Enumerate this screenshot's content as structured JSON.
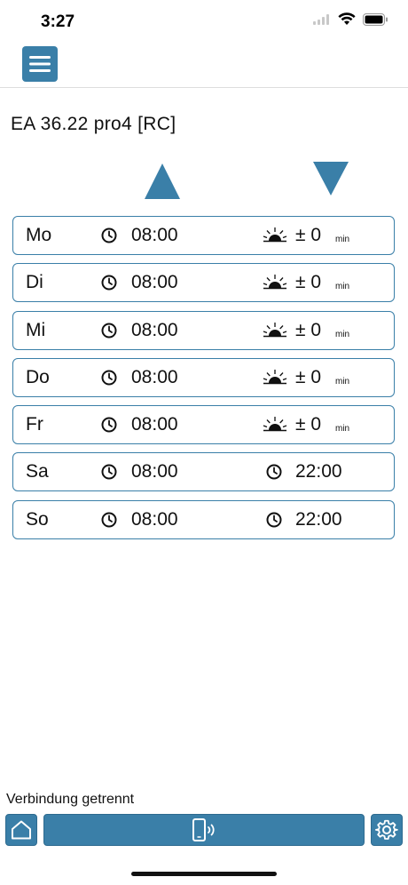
{
  "status_bar": {
    "time": "3:27"
  },
  "header": {
    "menu_icon": "hamburger-menu-icon"
  },
  "device": {
    "name": "EA 36.22 pro4 [RC]"
  },
  "colors": {
    "accent": "#3a7fa8",
    "border": "#3a7fa8"
  },
  "schedule": {
    "up_icon": "triangle-up-icon",
    "down_icon": "triangle-down-icon",
    "rows": [
      {
        "day": "Mo",
        "up_time": "08:00",
        "down_mode": "sunset",
        "down_offset": "± 0",
        "down_unit": "min"
      },
      {
        "day": "Di",
        "up_time": "08:00",
        "down_mode": "sunset",
        "down_offset": "± 0",
        "down_unit": "min"
      },
      {
        "day": "Mi",
        "up_time": "08:00",
        "down_mode": "sunset",
        "down_offset": "± 0",
        "down_unit": "min"
      },
      {
        "day": "Do",
        "up_time": "08:00",
        "down_mode": "sunset",
        "down_offset": "± 0",
        "down_unit": "min"
      },
      {
        "day": "Fr",
        "up_time": "08:00",
        "down_mode": "sunset",
        "down_offset": "± 0",
        "down_unit": "min"
      },
      {
        "day": "Sa",
        "up_time": "08:00",
        "down_mode": "time",
        "down_time": "22:00"
      },
      {
        "day": "So",
        "up_time": "08:00",
        "down_mode": "time",
        "down_time": "22:00"
      }
    ]
  },
  "footer": {
    "connection_status": "Verbindung getrennt",
    "home_icon": "home-icon",
    "connect_icon": "phone-signal-icon",
    "settings_icon": "gear-icon"
  }
}
